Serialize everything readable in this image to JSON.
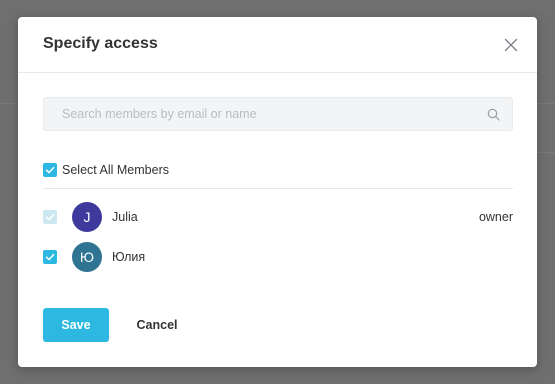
{
  "modal": {
    "title": "Specify access",
    "close_icon": "close-icon"
  },
  "search": {
    "placeholder": "Search members by email or name",
    "value": "",
    "icon": "search-icon"
  },
  "select_all": {
    "label": "Select All Members",
    "checked": true
  },
  "members": [
    {
      "initial": "J",
      "name": "Julia",
      "role": "owner",
      "checked": true,
      "disabled": true,
      "avatar_color": "#3e3a9b"
    },
    {
      "initial": "Ю",
      "name": "Юлия",
      "role": "",
      "checked": true,
      "disabled": false,
      "avatar_color": "#2f7492"
    }
  ],
  "actions": {
    "save_label": "Save",
    "cancel_label": "Cancel"
  },
  "colors": {
    "accent": "#2db8e1",
    "overlay": "#6f6f6f"
  }
}
